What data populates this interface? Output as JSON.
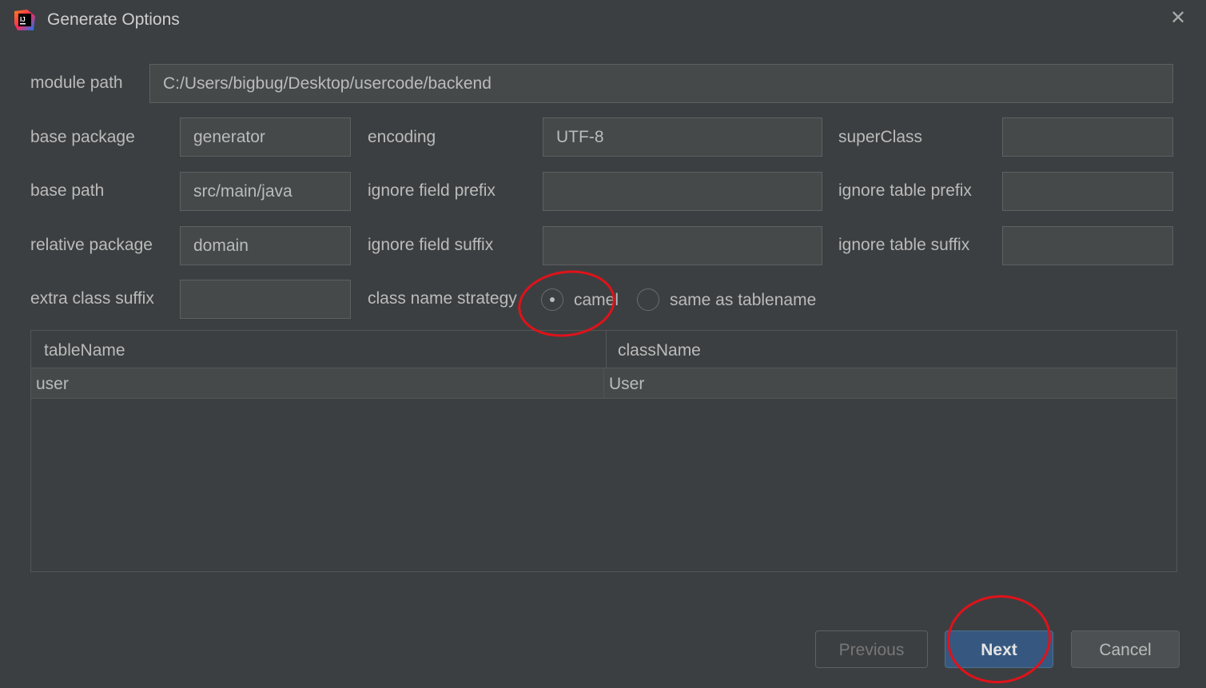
{
  "window": {
    "title": "Generate Options",
    "app_icon": "intellij-icon",
    "close_glyph": "✕"
  },
  "form": {
    "module_path": {
      "label": "module path",
      "value": "C:/Users/bigbug/Desktop/usercode/backend"
    },
    "base_package": {
      "label": "base package",
      "value": "generator"
    },
    "encoding": {
      "label": "encoding",
      "value": "UTF-8"
    },
    "super_class": {
      "label": "superClass",
      "value": ""
    },
    "base_path": {
      "label": "base path",
      "value": "src/main/java"
    },
    "ignore_field_prefix": {
      "label": "ignore field prefix",
      "value": ""
    },
    "ignore_table_prefix": {
      "label": "ignore table prefix",
      "value": ""
    },
    "relative_package": {
      "label": "relative package",
      "value": "domain"
    },
    "ignore_field_suffix": {
      "label": "ignore field suffix",
      "value": ""
    },
    "ignore_table_suffix": {
      "label": "ignore table suffix",
      "value": ""
    },
    "extra_class_suffix": {
      "label": "extra class suffix",
      "value": ""
    },
    "class_name_strategy": {
      "label": "class name strategy",
      "options": [
        {
          "label": "camel",
          "selected": true
        },
        {
          "label": "same as tablename",
          "selected": false
        }
      ]
    }
  },
  "table": {
    "columns": [
      "tableName",
      "className"
    ],
    "rows": [
      [
        "user",
        "User"
      ]
    ]
  },
  "buttons": {
    "previous": "Previous",
    "next": "Next",
    "cancel": "Cancel"
  },
  "colors": {
    "background": "#3c3f41",
    "field": "#45494a",
    "primary_button": "#365880",
    "annotation": "#e0121a"
  }
}
